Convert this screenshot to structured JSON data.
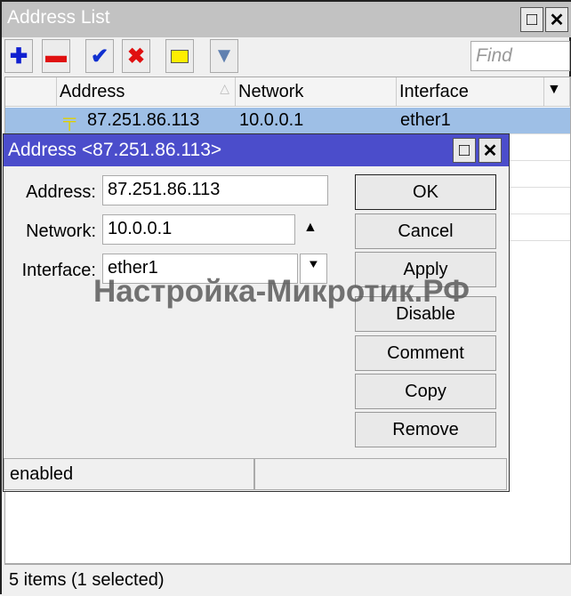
{
  "window": {
    "title": "Address List",
    "find_placeholder": "Find"
  },
  "toolbar": {
    "icons": [
      "plus-icon",
      "minus-icon",
      "check-icon",
      "cross-icon",
      "comment-icon",
      "filter-icon"
    ]
  },
  "table": {
    "columns": [
      "Address",
      "Network",
      "Interface"
    ],
    "rows": [
      {
        "address": "87.251.86.113",
        "network": "10.0.0.1",
        "interface": "ether1",
        "selected": true
      }
    ]
  },
  "status": "5 items (1 selected)",
  "dialog": {
    "title": "Address <87.251.86.113>",
    "fields": {
      "address_label": "Address:",
      "address": "87.251.86.113",
      "network_label": "Network:",
      "network": "10.0.0.1",
      "interface_label": "Interface:",
      "interface": "ether1"
    },
    "buttons": [
      "OK",
      "Cancel",
      "Apply",
      "Disable",
      "Comment",
      "Copy",
      "Remove"
    ],
    "status": "enabled"
  },
  "watermark": "Настройка-Микротик.РФ",
  "colors": {
    "selected_row": "#9ebfe6",
    "dialog_title": "#4b4dcb"
  }
}
